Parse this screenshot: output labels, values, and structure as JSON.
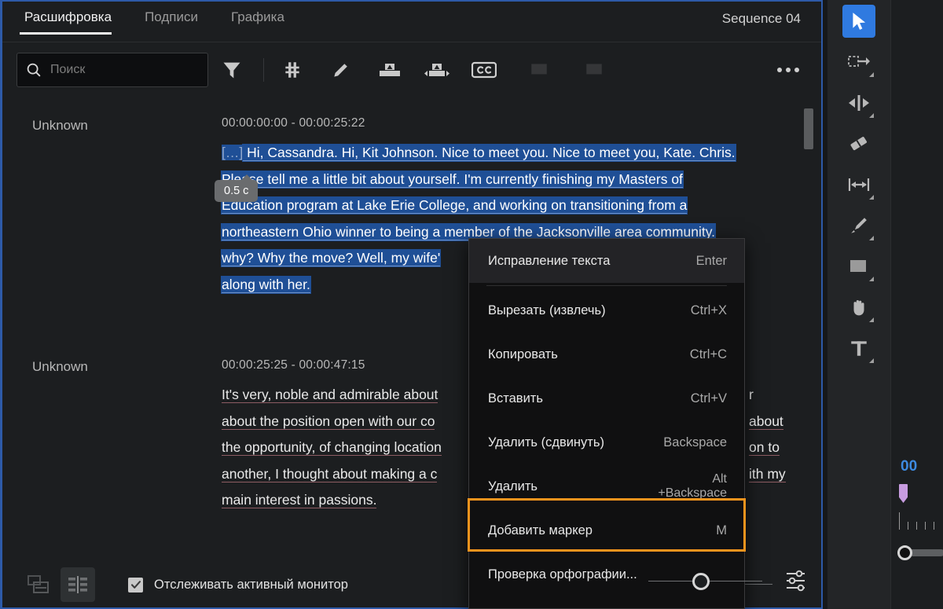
{
  "app": {
    "sequence_title": "Sequence 04"
  },
  "tabs": [
    {
      "label": "Расшифровка",
      "active": true
    },
    {
      "label": "Подписи",
      "active": false
    },
    {
      "label": "Графика",
      "active": false
    }
  ],
  "toolbar": {
    "search_placeholder": "Поиск",
    "search_value": "",
    "icons": [
      "filter-icon",
      "pause-gaps-icon",
      "edit-pencil-icon",
      "merge-clips-icon",
      "split-clips-icon",
      "cc-icon"
    ],
    "overflow_label": "•••"
  },
  "transcript": {
    "tooltip": "0.5 с",
    "blocks": [
      {
        "speaker": "Unknown",
        "timecode": "00:00:00:00 - 00:00:25:22",
        "lines": [
          "[...] Hi, Cassandra. Hi, Kit Johnson. Nice to meet you. Nice to meet you, Kate. Chris.",
          "Please tell me a little bit about yourself. I'm currently finishing my Masters of",
          "Education program at Lake Erie College, and working on transitioning from a",
          "northeastern Ohio winner to being a member of the Jacksonville area community.",
          "why? Why the move? Well, my wife' ... ning",
          "along with her."
        ]
      },
      {
        "speaker": "Unknown",
        "timecode": "00:00:25:25 - 00:00:47:15",
        "lines": [
          "It's very, noble and admirable about",
          "about the position open with our co",
          "the opportunity, of changing location",
          "another, I thought about making a c",
          "main interest in passions."
        ],
        "right_fragments": [
          "r",
          "about",
          "on to",
          "ith my"
        ]
      }
    ]
  },
  "context_menu": {
    "items": [
      {
        "label": "Исправление текста",
        "shortcut": "Enter",
        "hover": true,
        "highlighted": false
      },
      {
        "label": "Вырезать (извлечь)",
        "shortcut": "Ctrl+X",
        "hover": false,
        "highlighted": false
      },
      {
        "label": "Копировать",
        "shortcut": "Ctrl+C",
        "hover": false,
        "highlighted": false
      },
      {
        "label": "Вставить",
        "shortcut": "Ctrl+V",
        "hover": false,
        "highlighted": false
      },
      {
        "label": "Удалить (сдвинуть)",
        "shortcut": "Backspace",
        "hover": false,
        "highlighted": false
      },
      {
        "label": "Удалить",
        "shortcut": "Alt\n+Backspace",
        "shortcut_line1": "Alt",
        "shortcut_line2": "+Backspace",
        "hover": false,
        "highlighted": false
      },
      {
        "label": "Добавить маркер",
        "shortcut": "M",
        "hover": false,
        "highlighted": true
      },
      {
        "label": "Проверка орфографии...",
        "shortcut": "",
        "hover": false,
        "highlighted": false
      }
    ],
    "highlight_color": "#f3941d"
  },
  "bottom_bar": {
    "view_clip_icon": "clip-view-icon",
    "view_transcript_icon": "transcript-view-icon",
    "checkbox_checked": true,
    "checkbox_label": "Отслеживать активный монитор",
    "settings_icon": "sliders-icon"
  },
  "tool_column": [
    {
      "name": "selection-tool",
      "selected": true,
      "has_flyout": false
    },
    {
      "name": "track-select-forward-tool",
      "selected": false,
      "has_flyout": true
    },
    {
      "name": "ripple-edit-tool",
      "selected": false,
      "has_flyout": true
    },
    {
      "name": "razor-tool",
      "selected": false,
      "has_flyout": false
    },
    {
      "name": "slip-tool",
      "selected": false,
      "has_flyout": true
    },
    {
      "name": "pen-tool",
      "selected": false,
      "has_flyout": true
    },
    {
      "name": "rectangle-tool",
      "selected": false,
      "has_flyout": true
    },
    {
      "name": "hand-tool",
      "selected": false,
      "has_flyout": true
    },
    {
      "name": "type-tool",
      "selected": false,
      "has_flyout": true
    }
  ],
  "timeline": {
    "timecode": "00",
    "marker_color": "#c79ce0",
    "timecode_color": "#3d8ae0"
  }
}
